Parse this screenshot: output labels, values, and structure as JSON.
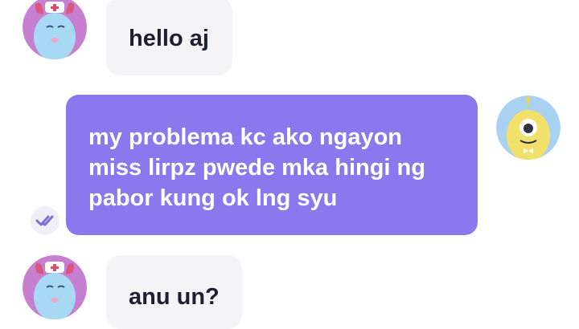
{
  "messages": [
    {
      "sender": "incoming",
      "text": "hello aj",
      "avatar_icon": "nurse-monster-avatar-icon"
    },
    {
      "sender": "outgoing",
      "lines": [
        "my problema kc ako ngayon",
        "miss lirpz pwede mka hingi ng",
        "pabor kung ok lng syu"
      ],
      "avatar_icon": "yellow-alien-avatar-icon",
      "status_icon": "double-check-read-icon"
    },
    {
      "sender": "incoming",
      "text": "anu un?",
      "avatar_icon": "nurse-monster-avatar-icon"
    }
  ],
  "colors": {
    "outgoing_bubble": "#8b78ee",
    "incoming_bubble": "#f4f4f6",
    "incoming_text": "#1d2030",
    "outgoing_text": "#ffffff",
    "read_check": "#7b6fd6"
  }
}
